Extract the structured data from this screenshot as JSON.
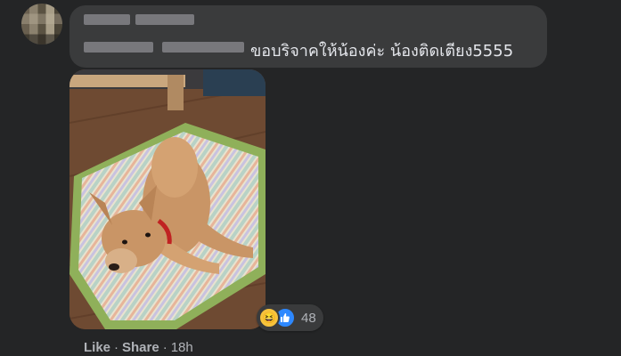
{
  "comment": {
    "text": "ขอบริจาคให้น้องค่ะ น้องติดเตียง5555",
    "author_name_hidden": true
  },
  "reactions": {
    "count": "48",
    "types": [
      "haha",
      "like"
    ]
  },
  "actions": {
    "like": "Like",
    "share": "Share",
    "separator": "·",
    "time": "18h"
  },
  "photo": {
    "subject": "dog-lying-on-cushion-photo"
  },
  "colors": {
    "background": "#242526",
    "bubble": "#3a3b3c",
    "text": "#e4e6eb",
    "secondary_text": "#b0b3b8",
    "like_blue": "#2d88ff",
    "haha_yellow": "#f7c33c"
  }
}
